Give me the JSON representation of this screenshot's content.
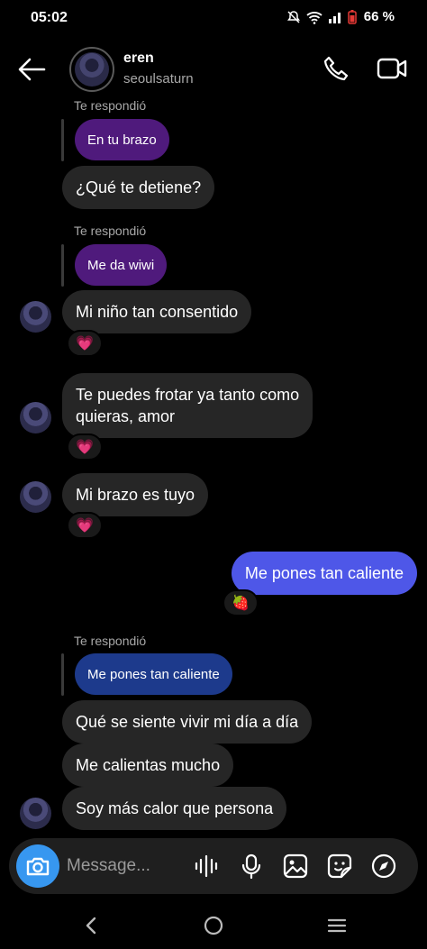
{
  "status_bar": {
    "time": "05:02",
    "battery": "66 %"
  },
  "header": {
    "name": "eren",
    "username": "seoulsaturn"
  },
  "messages": {
    "reply_label": "Te respondió",
    "m1_reply": "En tu brazo",
    "m1_text": "¿Qué te detiene?",
    "m2_reply": "Me da wiwi",
    "m2_text": "Mi niño tan consentido",
    "m3_line1": "Te puedes frotar ya tanto como",
    "m3_line2": "quieras, amor",
    "m4_text": "Mi brazo es tuyo",
    "m5_out": "Me pones tan caliente",
    "m6_reply": "Me pones tan caliente",
    "m6_text1": "Qué se siente vivir mi día a día",
    "m6_text2": "Me calientas mucho",
    "m6_text3": "Soy más calor que persona"
  },
  "reactions": {
    "heart": "💗",
    "strawberry": "🍓"
  },
  "composer": {
    "placeholder": "Message..."
  },
  "colors": {
    "accent": "#3797f0",
    "outgoing_bubble": "#4e57e8",
    "reply_purple": "#4f1a7c",
    "reply_blue": "#1d3a8c"
  }
}
